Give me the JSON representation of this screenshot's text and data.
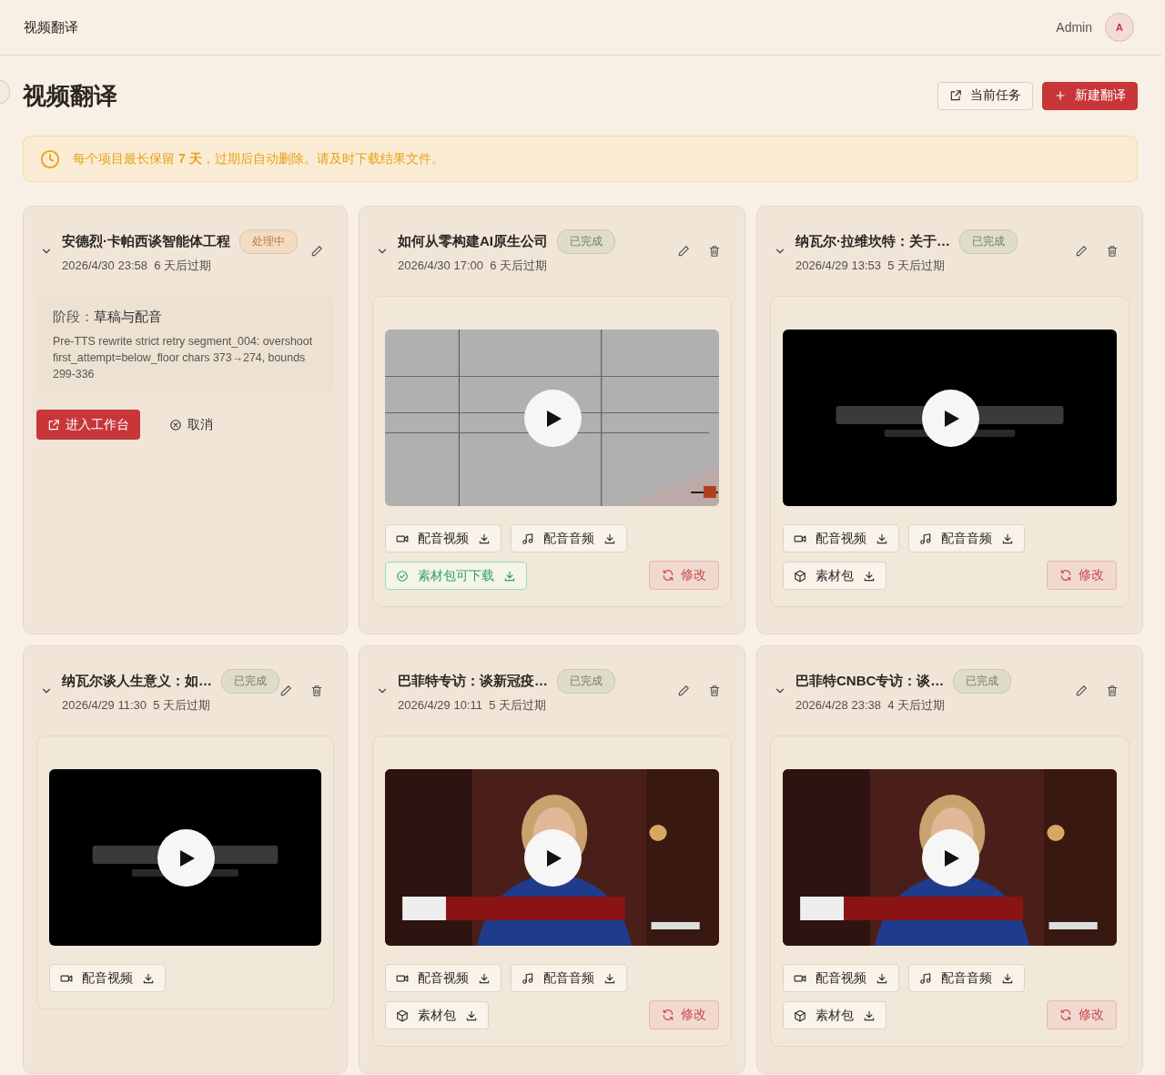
{
  "app_title": "视频翻译",
  "user": {
    "name": "Admin",
    "initial": "A"
  },
  "page_title": "视频翻译",
  "header_buttons": [
    {
      "kind": "outline",
      "label": "当前任务"
    },
    {
      "kind": "primary",
      "label": "新建翻译"
    }
  ],
  "notice": "每个项目最长保留 **7 天**，过期后自动删除。请及时下载结果文件。",
  "cards": [
    {
      "title": "安德烈·卡帕西谈智能体工程",
      "badge": {
        "kind": "processing",
        "label": "处理中"
      },
      "date": "2026/4/30 23:58",
      "expiry": "6 天后过期",
      "can_delete": false,
      "stage": {
        "label": "阶段：",
        "value": "草稿与配音",
        "message": "Pre-TTS rewrite strict retry segment_004: overshoot first_attempt=below_floor chars 373→274, bounds 299-336"
      },
      "actions": [
        {
          "kind": "primary",
          "label": "进入工作台"
        },
        {
          "kind": "cancel",
          "label": "取消"
        }
      ]
    },
    {
      "title": "如何从零构建AI原生公司",
      "badge": {
        "kind": "done",
        "label": "已完成"
      },
      "date": "2026/4/30 17:00",
      "expiry": "6 天后过期",
      "can_delete": true,
      "video": {
        "kind": "picture"
      },
      "downloads": [
        {
          "kind": "video",
          "label": "配音视频"
        },
        {
          "kind": "audio",
          "label": "配音音频"
        },
        {
          "kind": "package_ready",
          "label": "素材包可下载"
        }
      ],
      "revise": "修改"
    },
    {
      "title": "纳瓦尔·拉维坎特：关于…",
      "badge": {
        "kind": "done",
        "label": "已完成"
      },
      "date": "2026/4/29 13:53",
      "expiry": "5 天后过期",
      "can_delete": true,
      "video": {
        "kind": "picture"
      },
      "downloads": [
        {
          "kind": "video",
          "label": "配音视频"
        },
        {
          "kind": "audio",
          "label": "配音音频"
        },
        {
          "kind": "package",
          "label": "素材包"
        }
      ],
      "revise": "修改"
    },
    {
      "title": "纳瓦尔谈人生意义：如…",
      "badge": {
        "kind": "done",
        "label": "已完成"
      },
      "date": "2026/4/29 11:30",
      "expiry": "5 天后过期",
      "can_delete": true,
      "video": {
        "kind": "picture"
      },
      "downloads": [
        {
          "kind": "video",
          "label": "配音视频"
        }
      ]
    },
    {
      "title": "巴菲特专访：谈新冠疫…",
      "badge": {
        "kind": "done",
        "label": "已完成"
      },
      "date": "2026/4/29 10:11",
      "expiry": "5 天后过期",
      "can_delete": true,
      "video": {
        "kind": "picture"
      },
      "downloads": [
        {
          "kind": "video",
          "label": "配音视频"
        },
        {
          "kind": "audio",
          "label": "配音音频"
        },
        {
          "kind": "package",
          "label": "素材包"
        }
      ],
      "revise": "修改"
    },
    {
      "title": "巴菲特CNBC专访：谈…",
      "badge": {
        "kind": "done",
        "label": "已完成"
      },
      "date": "2026/4/28 23:38",
      "expiry": "4 天后过期",
      "can_delete": true,
      "video": {
        "kind": "picture"
      },
      "downloads": [
        {
          "kind": "video",
          "label": "配音视频"
        },
        {
          "kind": "audio",
          "label": "配音音频"
        },
        {
          "kind": "package",
          "label": "素材包"
        }
      ],
      "revise": "修改"
    }
  ]
}
